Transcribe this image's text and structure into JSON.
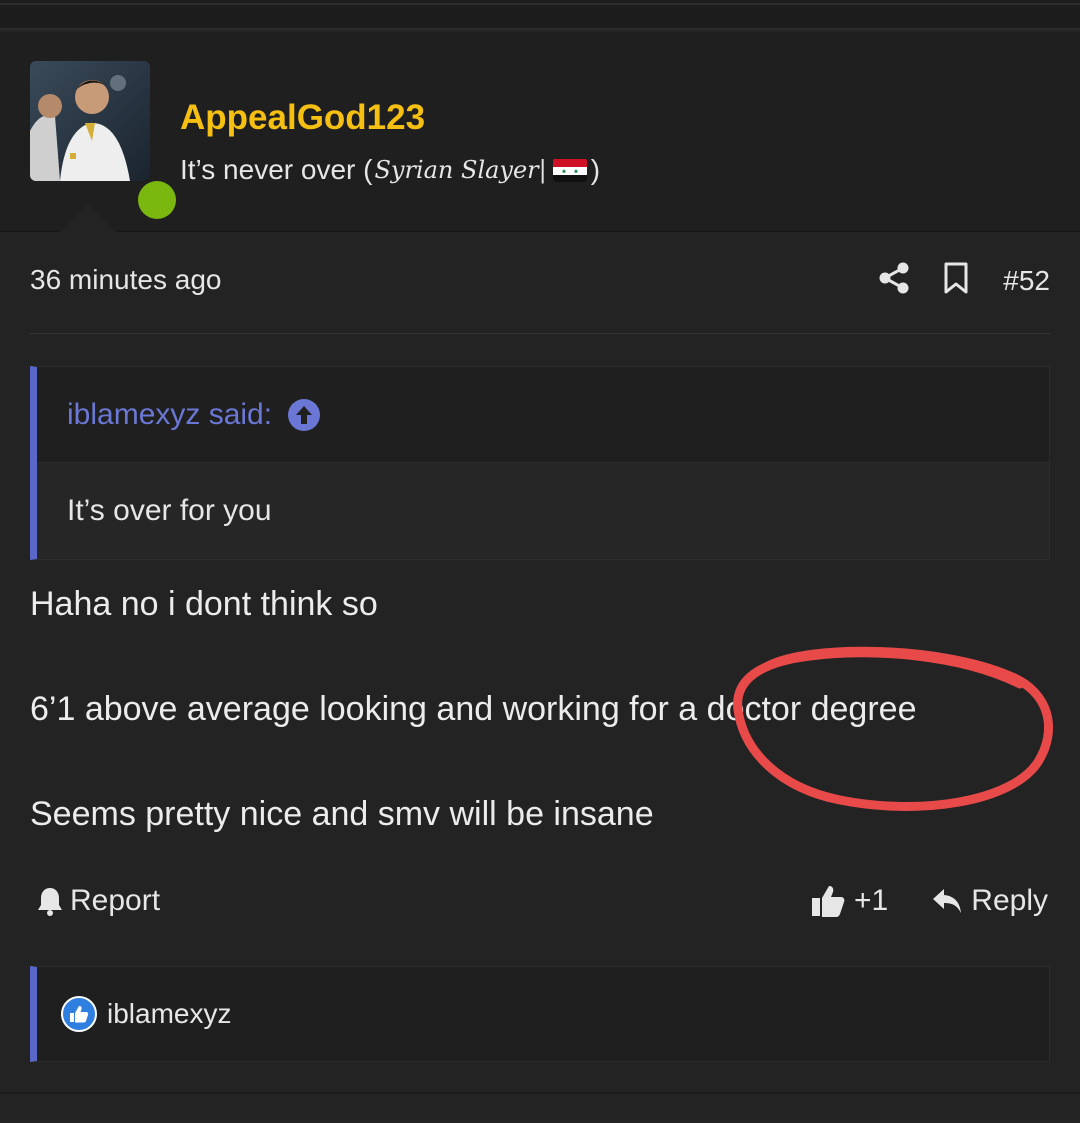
{
  "post": {
    "author": {
      "username": "AppealGod123",
      "title_prefix": "It’s never over (",
      "title_script": "Syrian Slayer|",
      "title_suffix": ")",
      "flag_icon": "syria-flag-icon",
      "online": true
    },
    "time_ago": "36 minutes ago",
    "post_number": "#52",
    "icons": {
      "share": "share-icon",
      "bookmark": "bookmark-icon"
    },
    "quote": {
      "author_label": "iblamexyz said:",
      "text": "It’s over for you"
    },
    "body": {
      "line_1": "Haha no i dont think so",
      "line_2": "6’1 above average looking and working for a doctor degree",
      "line_3": "Seems pretty nice and smv will be insane"
    },
    "actions": {
      "report_label": "Report",
      "like_count": "+1",
      "reply_label": "Reply"
    },
    "reactions": {
      "users": [
        "iblamexyz"
      ]
    }
  },
  "colors": {
    "username": "#f5c012",
    "quote_accent": "#5a67c8",
    "online_dot": "#7ab80f",
    "annotation_circle": "#e84a4a"
  }
}
